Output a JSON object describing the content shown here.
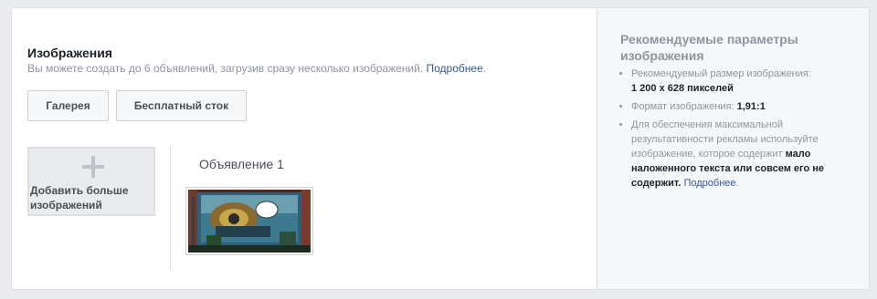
{
  "images": {
    "title": "Изображения",
    "subtitle_text": "Вы можете создать до 6 объявлений, загрузив сразу несколько изображений.",
    "learn_more": "Подробнее",
    "gallery_button": "Галерея",
    "stock_button": "Бесплатный сток",
    "add_more_label": "Добавить больше изображений",
    "ad_label": "Объявление 1"
  },
  "recommendations": {
    "title": "Рекомендуемые параметры изображения",
    "size_label": "Рекомендуемый размер изображения:",
    "size_value": "1 200 x 628 пикселей",
    "ratio_label": "Формат изображения:",
    "ratio_value": "1,91:1",
    "text_tip_start": "Для обеспечения максимальной результативности рекламы используйте изображение, которое содержит",
    "text_tip_bold": "мало наложенного текста или совсем его не содержит.",
    "learn_more": "Подробнее"
  },
  "colors": {
    "link": "#365899",
    "muted": "#90949c",
    "background": "#e9ebee"
  },
  "icons": {
    "add": "plus-icon"
  }
}
